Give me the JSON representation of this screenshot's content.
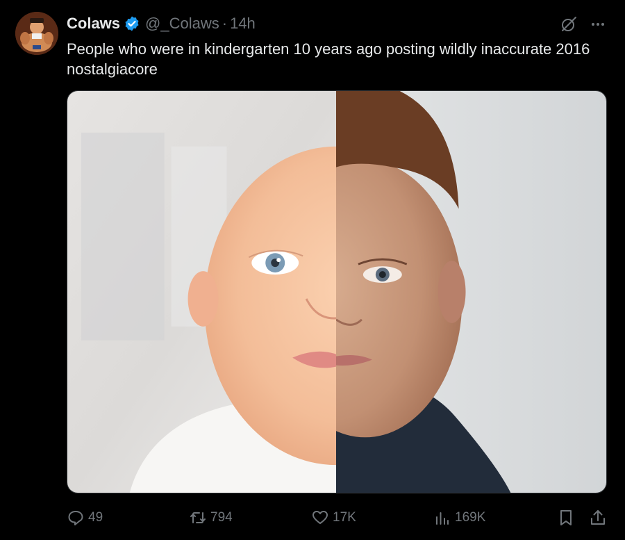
{
  "author": {
    "display_name": "Colaws",
    "handle": "@_Colaws",
    "separator": "·",
    "time": "14h",
    "verified": true,
    "verified_color": "#1d9bf0"
  },
  "tweet": {
    "text": "People who were in kindergarten 10 years ago posting wildly inaccurate 2016 nostalgiacore"
  },
  "icons": {
    "avatar": "avatar-image",
    "grok": "grok-icon",
    "more": "more-icon",
    "reply": "reply-icon",
    "repost": "repost-icon",
    "like": "like-icon",
    "views": "views-icon",
    "bookmark": "bookmark-icon",
    "share": "share-icon"
  },
  "stats": {
    "replies": "49",
    "reposts": "794",
    "likes": "17K",
    "views": "169K"
  },
  "colors": {
    "background": "#000000",
    "text": "#e7e9ea",
    "muted": "#71767b"
  }
}
